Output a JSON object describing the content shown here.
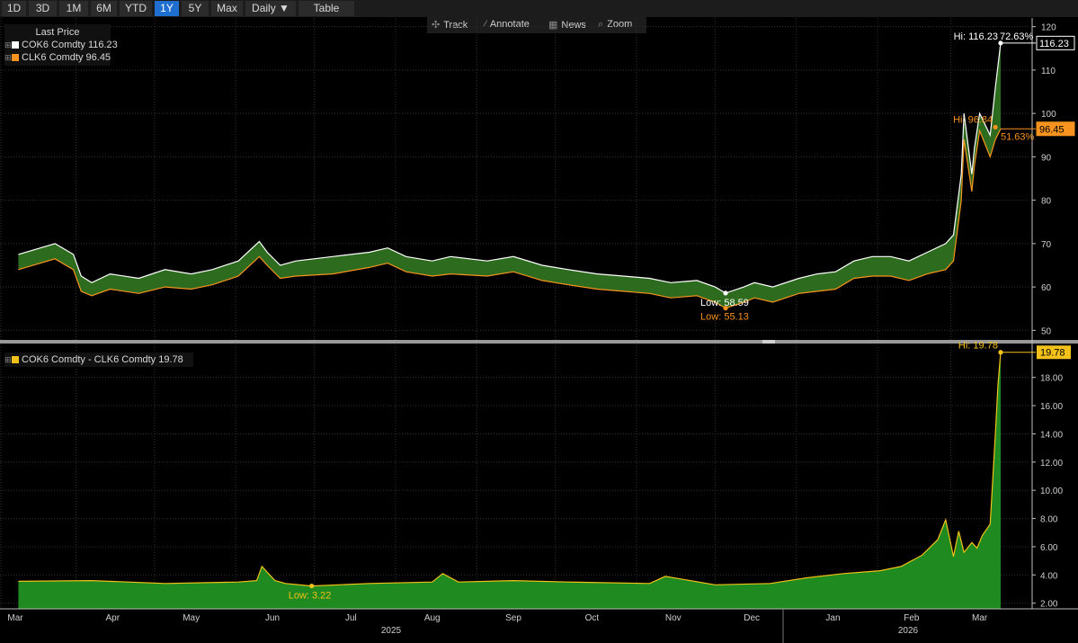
{
  "toolbar": {
    "periods": [
      "1D",
      "3D",
      "1M",
      "6M",
      "YTD",
      "1Y",
      "5Y",
      "Max"
    ],
    "active": "1Y",
    "frequency": "Daily ▼",
    "table": "Table"
  },
  "subbar": {
    "track": "Track",
    "annotate": "Annotate",
    "news": "News",
    "zoom": "Zoom"
  },
  "legend_top": {
    "title": "Last Price",
    "items": [
      {
        "label": "COK6 Comdty 116.23",
        "color": "#ffffff"
      },
      {
        "label": "CLK6 Comdty  96.45",
        "color": "#f7931e"
      }
    ]
  },
  "legend_bottom": {
    "label": "COK6 Comdty - CLK6 Comdty 19.78",
    "color": "#f2c11a"
  },
  "colors": {
    "co": "#ffffff",
    "cl": "#f7931e",
    "fill_top": "#2d6b1f",
    "spread_line": "#f2c11a",
    "fill_bottom": "#1f8a1f"
  },
  "chart_data": [
    {
      "type": "line",
      "ylim": [
        48,
        122
      ],
      "yticks": [
        50,
        60,
        70,
        80,
        90,
        100,
        110,
        120
      ],
      "x": [
        "2025-03-10",
        "2025-03-24",
        "2025-03-31",
        "2025-04-03",
        "2025-04-07",
        "2025-04-14",
        "2025-04-25",
        "2025-05-05",
        "2025-05-15",
        "2025-05-23",
        "2025-06-02",
        "2025-06-10",
        "2025-06-13",
        "2025-06-18",
        "2025-06-24",
        "2025-07-08",
        "2025-07-22",
        "2025-07-29",
        "2025-08-05",
        "2025-08-15",
        "2025-08-22",
        "2025-09-05",
        "2025-09-15",
        "2025-09-26",
        "2025-10-06",
        "2025-10-17",
        "2025-10-27",
        "2025-11-06",
        "2025-11-14",
        "2025-11-24",
        "2025-12-01",
        "2025-12-05",
        "2025-12-12",
        "2025-12-16",
        "2025-12-23",
        "2026-01-02",
        "2026-01-09",
        "2026-01-16",
        "2026-01-23",
        "2026-01-30",
        "2026-02-06",
        "2026-02-13",
        "2026-02-20",
        "2026-02-27",
        "2026-03-02",
        "2026-03-05",
        "2026-03-06",
        "2026-03-09",
        "2026-03-10",
        "2026-03-12",
        "2026-03-16",
        "2026-03-18",
        "2026-03-20"
      ],
      "series": [
        {
          "name": "COK6 Comdty",
          "values": [
            67.5,
            70,
            67.5,
            62.5,
            61,
            63,
            62,
            64,
            63,
            64,
            66,
            70.5,
            68,
            65,
            66,
            67,
            68,
            69,
            67,
            66,
            67,
            66,
            67,
            65,
            64,
            63,
            62.5,
            62,
            61,
            61.5,
            60,
            58.59,
            60,
            61,
            60,
            62,
            63,
            63.5,
            66,
            67,
            67,
            66,
            68,
            70,
            72,
            86,
            100,
            86,
            92,
            100,
            95,
            106,
            116.23
          ]
        },
        {
          "name": "CLK6 Comdty",
          "values": [
            64,
            66.5,
            64,
            59,
            58,
            59.5,
            58.5,
            60,
            59.5,
            60.5,
            62.5,
            67,
            65,
            62,
            62.5,
            63,
            64.5,
            65.5,
            63.5,
            62.5,
            63,
            62.5,
            63.5,
            61.5,
            60.5,
            59.5,
            59,
            58.5,
            57.5,
            58,
            56.5,
            55.13,
            56.5,
            57.5,
            56.5,
            58.5,
            59,
            59.5,
            62,
            62.5,
            62.5,
            61.5,
            63,
            64,
            66,
            80,
            94,
            82,
            88,
            96,
            90,
            94,
            96.45
          ]
        }
      ],
      "annotations": [
        {
          "text": "Hi: 116.23",
          "pct": "72.63%"
        },
        {
          "text": "Hi: 96.84",
          "pct": "51.63%"
        },
        {
          "text": "Low: 58.59"
        },
        {
          "text": "Low: 55.13"
        }
      ],
      "last_labels": [
        "116.23",
        "96.45"
      ]
    },
    {
      "type": "area",
      "ylim": [
        1.6,
        20.4
      ],
      "yticks": [
        "2.00",
        "4.00",
        "6.00",
        "8.00",
        "10.00",
        "12.00",
        "14.00",
        "16.00",
        "18.00"
      ],
      "x": [
        "2025-03-10",
        "2025-04-07",
        "2025-05-05",
        "2025-06-02",
        "2025-06-09",
        "2025-06-11",
        "2025-06-16",
        "2025-06-20",
        "2025-06-30",
        "2025-07-22",
        "2025-08-15",
        "2025-08-19",
        "2025-08-25",
        "2025-09-15",
        "2025-10-06",
        "2025-11-06",
        "2025-11-12",
        "2025-12-01",
        "2025-12-22",
        "2026-01-05",
        "2026-01-19",
        "2026-02-02",
        "2026-02-10",
        "2026-02-18",
        "2026-02-24",
        "2026-02-27",
        "2026-03-02",
        "2026-03-04",
        "2026-03-06",
        "2026-03-09",
        "2026-03-11",
        "2026-03-13",
        "2026-03-16",
        "2026-03-18",
        "2026-03-19",
        "2026-03-20"
      ],
      "series": [
        {
          "name": "COK6 Comdty - CLK6 Comdty",
          "values": [
            3.55,
            3.6,
            3.4,
            3.5,
            3.6,
            4.6,
            3.6,
            3.4,
            3.22,
            3.4,
            3.5,
            4.1,
            3.5,
            3.6,
            3.5,
            3.4,
            3.9,
            3.3,
            3.4,
            3.8,
            4.1,
            4.3,
            4.6,
            5.4,
            6.5,
            7.9,
            5.3,
            7.1,
            5.6,
            6.3,
            5.9,
            6.8,
            7.6,
            14,
            17.5,
            19.78
          ]
        }
      ],
      "annotations": [
        {
          "text": "Hi: 19.78"
        },
        {
          "text": "Low: 3.22"
        }
      ],
      "last_labels": [
        "19.78"
      ]
    }
  ],
  "x_axis": {
    "months": [
      "Mar",
      "Apr",
      "May",
      "Jun",
      "Jul",
      "Aug",
      "Sep",
      "Oct",
      "Nov",
      "Dec",
      "Jan",
      "Feb",
      "Mar"
    ],
    "years": [
      "2025",
      "2026"
    ]
  }
}
